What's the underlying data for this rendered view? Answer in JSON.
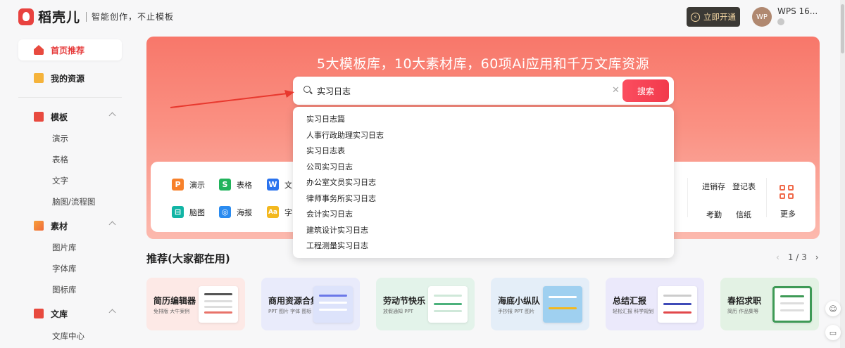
{
  "header": {
    "logo_text": "稻壳儿",
    "slogan": "智能创作，不止模板",
    "vip_label": "立即开通",
    "avatar_initials": "WP",
    "username": "WPS 16..."
  },
  "sidebar": {
    "home": "首页推荐",
    "resources": "我的资源",
    "templates": {
      "label": "模板",
      "items": [
        "演示",
        "表格",
        "文字",
        "脑图/流程图"
      ]
    },
    "materials": {
      "label": "素材",
      "items": [
        "图片库",
        "字体库",
        "图标库"
      ]
    },
    "library": {
      "label": "文库",
      "items": [
        "文库中心"
      ]
    }
  },
  "banner": {
    "title": "5大模板库，10大素材库，60项Ai应用和千万文库资源"
  },
  "search": {
    "value": "实习日志",
    "button": "搜索",
    "suggestions": [
      "实习日志篇",
      "人事行政助理实习日志",
      "实习日志表",
      "公司实习日志",
      "办公室文员实习日志",
      "律师事务所实习日志",
      "会计实习日志",
      "建筑设计实习日志",
      "工程测量实习日志"
    ]
  },
  "tools": {
    "row1": [
      {
        "label": "演示",
        "glyph": "P",
        "color": "#f7812b"
      },
      {
        "label": "表格",
        "glyph": "S",
        "color": "#21b35c"
      },
      {
        "label": "文",
        "glyph": "W",
        "color": "#2a73ee"
      }
    ],
    "row2": [
      {
        "label": "脑图",
        "glyph": "⊟",
        "color": "#12b5a5"
      },
      {
        "label": "海报",
        "glyph": "◎",
        "color": "#2a8bf0"
      },
      {
        "label": "字",
        "glyph": "Aa",
        "color": "#f3b81f"
      }
    ],
    "right": [
      "进销存",
      "登记表",
      "考勤",
      "信纸"
    ],
    "more": "更多"
  },
  "recommend": {
    "title": "推荐(大家都在用)",
    "page": "1 / 3",
    "cards": [
      {
        "title": "简历编辑器",
        "sub": "免排版 大牛案例",
        "bg": "#fde9e6",
        "accent": "#e8736a"
      },
      {
        "title": "商用资源合集",
        "sub": "PPT 图片 字体 图标",
        "bg": "#e9ebfb",
        "accent": "#6b78e8"
      },
      {
        "title": "劳动节快乐",
        "sub": "放假通知 PPT",
        "bg": "#e3f3ea",
        "accent": "#4cb17c"
      },
      {
        "title": "海底小纵队",
        "sub": "手抄报 PPT 图片",
        "bg": "#e4eef8",
        "accent": "#3f8fd6"
      },
      {
        "title": "总结汇报",
        "sub": "轻松汇报 科学规划",
        "bg": "#ebe9fb",
        "accent": "#e2484b"
      },
      {
        "title": "春招求职",
        "sub": "简历 作品集等",
        "bg": "#e3f2e4",
        "accent": "#3e9a56"
      }
    ]
  },
  "colors": {
    "brand_red": "#e8423f",
    "banner_top": "#f8776a",
    "search_button": "#f23a4c",
    "vip_bg": "#3b3935"
  }
}
